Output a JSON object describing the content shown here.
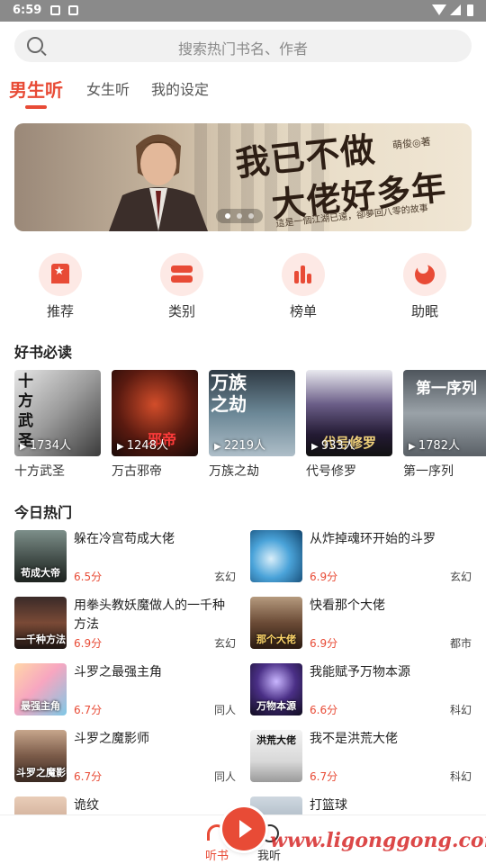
{
  "status_bar": {
    "time": "6:59"
  },
  "search": {
    "placeholder": "搜索热门书名、作者"
  },
  "tabs": [
    {
      "label": "男生听",
      "active": true
    },
    {
      "label": "女生听",
      "active": false
    },
    {
      "label": "我的设定",
      "active": false
    }
  ],
  "banner": {
    "title_line1": "我已不做",
    "title_line2": "大佬好多年",
    "author": "萌俊◎著",
    "tagline": "這是一個江湖已遠，卻夢回八零的故事",
    "page_count": 3,
    "active_page": 1
  },
  "categories": [
    {
      "label": "推荐",
      "icon": "recommend-icon"
    },
    {
      "label": "类别",
      "icon": "category-icon"
    },
    {
      "label": "榜单",
      "icon": "ranking-icon"
    },
    {
      "label": "助眠",
      "icon": "sleep-icon"
    }
  ],
  "must_read": {
    "title": "好书必读",
    "books": [
      {
        "name": "十方武圣",
        "listeners": "1734人",
        "cover_text": "十方武圣"
      },
      {
        "name": "万古邪帝",
        "listeners": "1248人",
        "cover_text": "万古邪帝"
      },
      {
        "name": "万族之劫",
        "listeners": "2219人",
        "cover_text": "万族之劫"
      },
      {
        "name": "代号修罗",
        "listeners": "933人",
        "cover_text": "代号修罗"
      },
      {
        "name": "第一序列",
        "listeners": "1782人",
        "cover_text": "第一序列"
      }
    ]
  },
  "today_hot": {
    "title": "今日热门",
    "items": [
      {
        "title": "躲在冷宫苟成大佬",
        "score": "6.5分",
        "genre": "玄幻",
        "thumb_text": "苟成大帝"
      },
      {
        "title": "从炸掉魂环开始的斗罗",
        "score": "6.9分",
        "genre": "玄幻",
        "thumb_text": ""
      },
      {
        "title": "用拳头教妖魔做人的一千种方法",
        "score": "6.9分",
        "genre": "玄幻",
        "thumb_text": "一千种方法"
      },
      {
        "title": "快看那个大佬",
        "score": "6.9分",
        "genre": "都市",
        "thumb_text": "那个大佬"
      },
      {
        "title": "斗罗之最强主角",
        "score": "6.7分",
        "genre": "同人",
        "thumb_text": "最强主角"
      },
      {
        "title": "我能赋予万物本源",
        "score": "6.6分",
        "genre": "科幻",
        "thumb_text": "万物本源"
      },
      {
        "title": "斗罗之魔影师",
        "score": "6.7分",
        "genre": "同人",
        "thumb_text": "斗罗之魔影师"
      },
      {
        "title": "我不是洪荒大佬",
        "score": "6.7分",
        "genre": "科幻",
        "thumb_text": "洪荒大佬"
      },
      {
        "title": "诡纹",
        "score": "",
        "genre": "",
        "thumb_text": ""
      },
      {
        "title": "打篮球",
        "score": "",
        "genre": "",
        "thumb_text": ""
      }
    ]
  },
  "bottom_nav": {
    "items": [
      {
        "label": "听书",
        "active": true
      },
      {
        "label": "我听",
        "active": false
      }
    ]
  },
  "watermark": "www.ligonggong.com",
  "colors": {
    "accent": "#e84b36",
    "status_bar": "#8a8a8a",
    "icon_bg": "#fde9e5"
  }
}
